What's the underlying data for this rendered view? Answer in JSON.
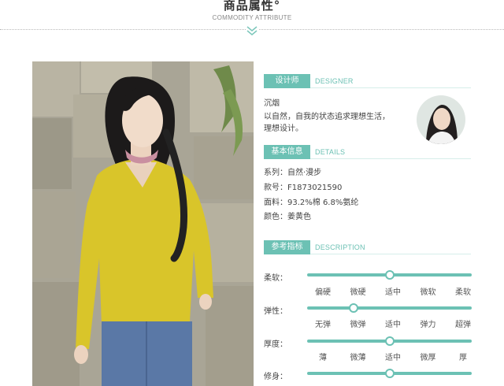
{
  "header": {
    "title": "商品属性°",
    "subtitle": "COMMODITY ATTRIBUTE"
  },
  "designer": {
    "badge": "设计师",
    "label_en": "DESIGNER",
    "name": "沉烟",
    "quote_line1": "以自然，自我的状态追求理想生活，",
    "quote_line2": "理想设计。"
  },
  "details": {
    "badge": "基本信息",
    "label_en": "DETAILS",
    "series": "系列：自然·漫步",
    "code": "款号：F1873021590",
    "fabric": "面料：93.2%棉 6.8%氨纶",
    "color": "颜色：姜黄色"
  },
  "description": {
    "badge": "参考指标",
    "label_en": "DESCRIPTION",
    "scales": [
      {
        "label": "柔软：",
        "options": [
          "偏硬",
          "微硬",
          "适中",
          "微软",
          "柔软"
        ],
        "value": 0.5
      },
      {
        "label": "弹性：",
        "options": [
          "无弹",
          "微弹",
          "适中",
          "弹力",
          "超弹"
        ],
        "value": 0.28
      },
      {
        "label": "厚度：",
        "options": [
          "薄",
          "微薄",
          "适中",
          "微厚",
          "厚"
        ],
        "value": 0.5
      },
      {
        "label": "修身：",
        "options": [
          "",
          "",
          "",
          "",
          ""
        ],
        "value": 0.5
      }
    ]
  },
  "colors": {
    "accent": "#6cc1b4",
    "shirt": "#d9c52a",
    "jeans": "#5a78a6"
  },
  "icons": {
    "header_chevron": "chevron-down-icon"
  }
}
